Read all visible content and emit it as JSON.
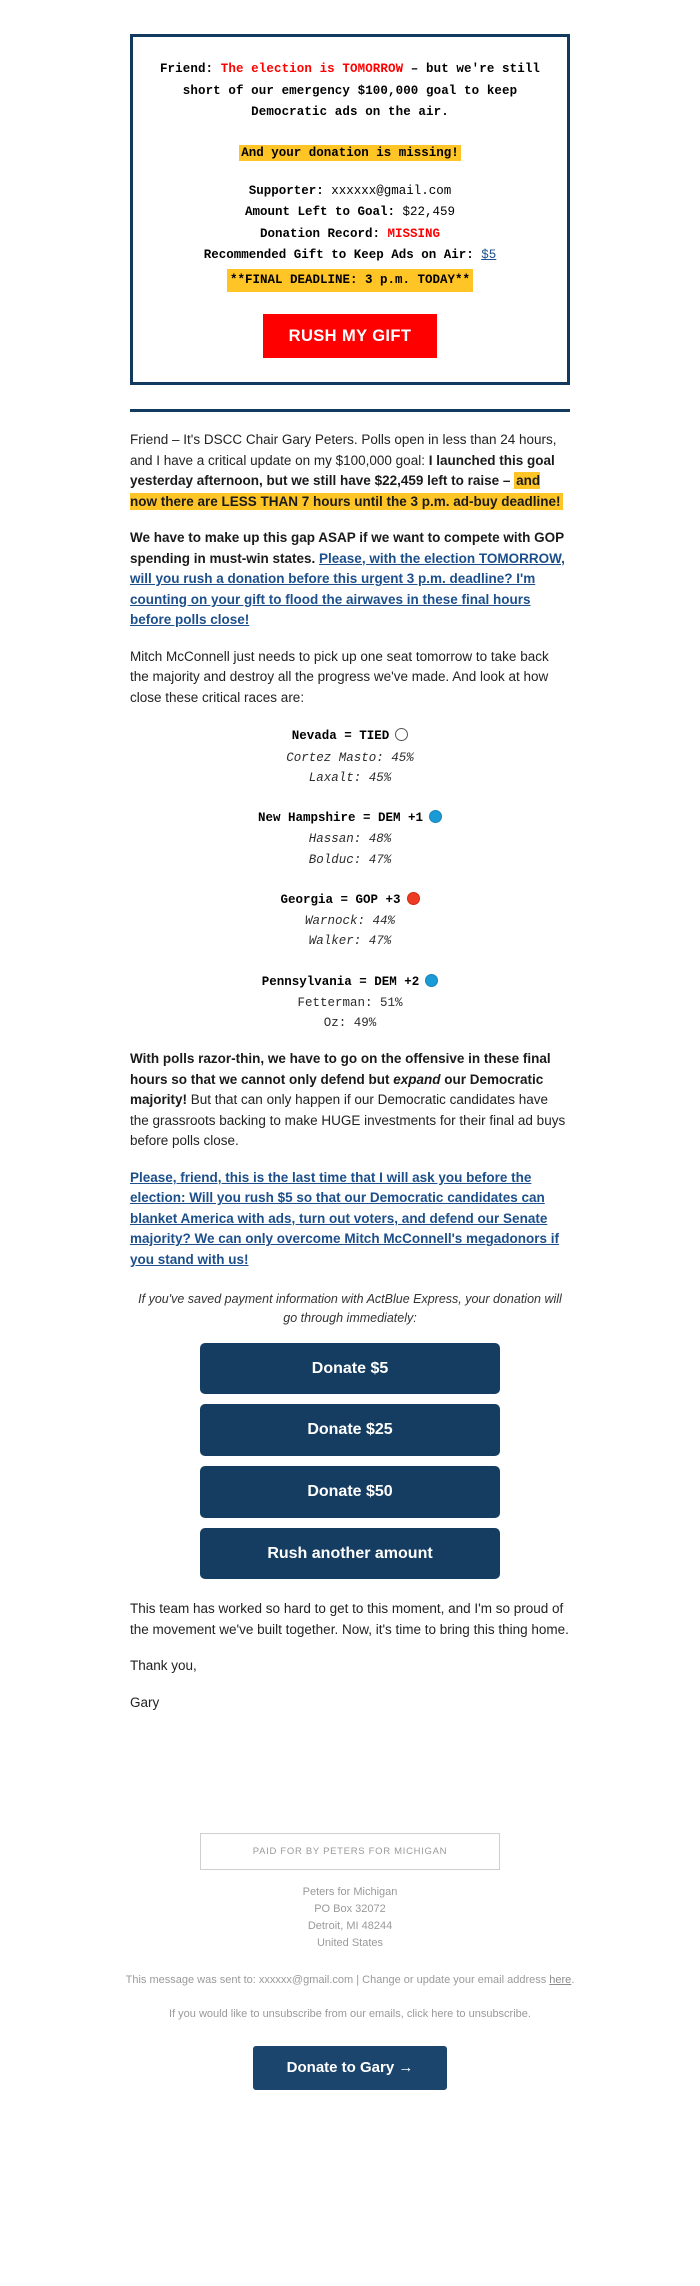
{
  "alert": {
    "headline_pre": "Friend: ",
    "headline_red": "The election is TOMORROW",
    "headline_post": " – but we're still short of our emergency $100,000 goal to keep Democratic ads on the air.",
    "subline": "And your donation is missing!",
    "details": [
      {
        "label": "Supporter:",
        "value": "xxxxxx@gmail.com",
        "style": "plain"
      },
      {
        "label": "Amount Left to Goal:",
        "value": "$22,459",
        "style": "plain"
      },
      {
        "label": "Donation Record:",
        "value": "MISSING",
        "style": "red"
      },
      {
        "label": "Recommended Gift to Keep Ads on Air:",
        "value": "$5",
        "style": "link"
      }
    ],
    "deadline": "**FINAL DEADLINE: 3 p.m. TODAY**",
    "rush_button": "RUSH MY GIFT"
  },
  "body": {
    "p1_a": "Friend – It's DSCC Chair Gary Peters. Polls open in less than 24 hours, and I have a critical update on my $100,000 goal: ",
    "p1_b": "I launched this goal yesterday afternoon, but we still have $22,459 left to raise – ",
    "p1_c": "and now there are LESS THAN 7 hours until the 3 p.m. ad-buy deadline!",
    "p2_a": "We have to make up this gap ASAP if we want to compete with GOP spending in must-win states. ",
    "p2_b": "Please, with the election TOMORROW, will you rush a donation before this urgent 3 p.m. deadline? I'm counting on your gift to flood the airwaves in these final hours before polls close!",
    "p3": "Mitch McConnell just needs to pick up one seat tomorrow to take back the majority and destroy all the progress we've made. And look at how close these critical races are:",
    "p4_a": "With polls razor-thin, we have to go on the offensive in these final hours so that we cannot only defend but ",
    "p4_em": "expand",
    "p4_b": " our Democratic majority!",
    "p4_c": " But that can only happen if our Democratic candidates have the grassroots backing to make HUGE investments for their final ad buys before polls close.",
    "p5": "Please, friend, this is the last time that I will ask you before the election: Will you rush $5 so that our Democratic candidates can blanket America with ads, turn out voters, and defend our Senate majority? We can only overcome Mitch McConnell's megadonors if you stand with us!",
    "express_note": "If you've saved payment information with ActBlue Express, your donation will go through immediately:",
    "closing_1": "This team has worked so hard to get to this moment, and I'm so proud of the movement we've built together. Now, it's time to bring this thing home.",
    "closing_2": "Thank you,",
    "closing_3": "Gary"
  },
  "polls": [
    {
      "title": "Nevada = TIED",
      "indicator": "tied-circle-icon",
      "indicator_color": "#ffffff",
      "lines": [
        {
          "text": "Cortez Masto: 45%",
          "italic": true
        },
        {
          "text": "Laxalt: 45%",
          "italic": true
        }
      ]
    },
    {
      "title": "New Hampshire = DEM +1",
      "indicator": "dem-circle-icon",
      "indicator_color": "#1a9ad6",
      "lines": [
        {
          "text": "Hassan: 48%",
          "italic": true
        },
        {
          "text": "Bolduc: 47%",
          "italic": true
        }
      ]
    },
    {
      "title": "Georgia = GOP +3",
      "indicator": "gop-circle-icon",
      "indicator_color": "#ee3b24",
      "lines": [
        {
          "text": "Warnock: 44%",
          "italic": true
        },
        {
          "text": "Walker: 47%",
          "italic": true
        }
      ]
    },
    {
      "title": "Pennsylvania = DEM +2",
      "indicator": "dem-circle-icon",
      "indicator_color": "#1a9ad6",
      "lines": [
        {
          "text": "Fetterman: 51%",
          "italic": false
        },
        {
          "text": "Oz: 49%",
          "italic": false
        }
      ]
    }
  ],
  "donate_buttons": [
    "Donate $5",
    "Donate $25",
    "Donate $50",
    "Rush another amount"
  ],
  "footer": {
    "paid_for": "PAID FOR BY PETERS FOR MICHIGAN",
    "address": [
      "Peters for Michigan",
      "PO Box 32072",
      "Detroit, MI 48244",
      "United States"
    ],
    "sent_to_pre": "This message was sent to: xxxxxx@gmail.com | Change or update your email address ",
    "sent_to_link": "here",
    "sent_to_post": ".",
    "unsubscribe_pre": "If you would like to unsubscribe from our emails, click here to unsubscribe.",
    "cta": "Donate to Gary →"
  },
  "colors": {
    "navy": "#123a5e",
    "red": "#ff0000",
    "highlight": "#ffc425",
    "link": "#1c4f8b",
    "button_navy": "#153d61"
  }
}
